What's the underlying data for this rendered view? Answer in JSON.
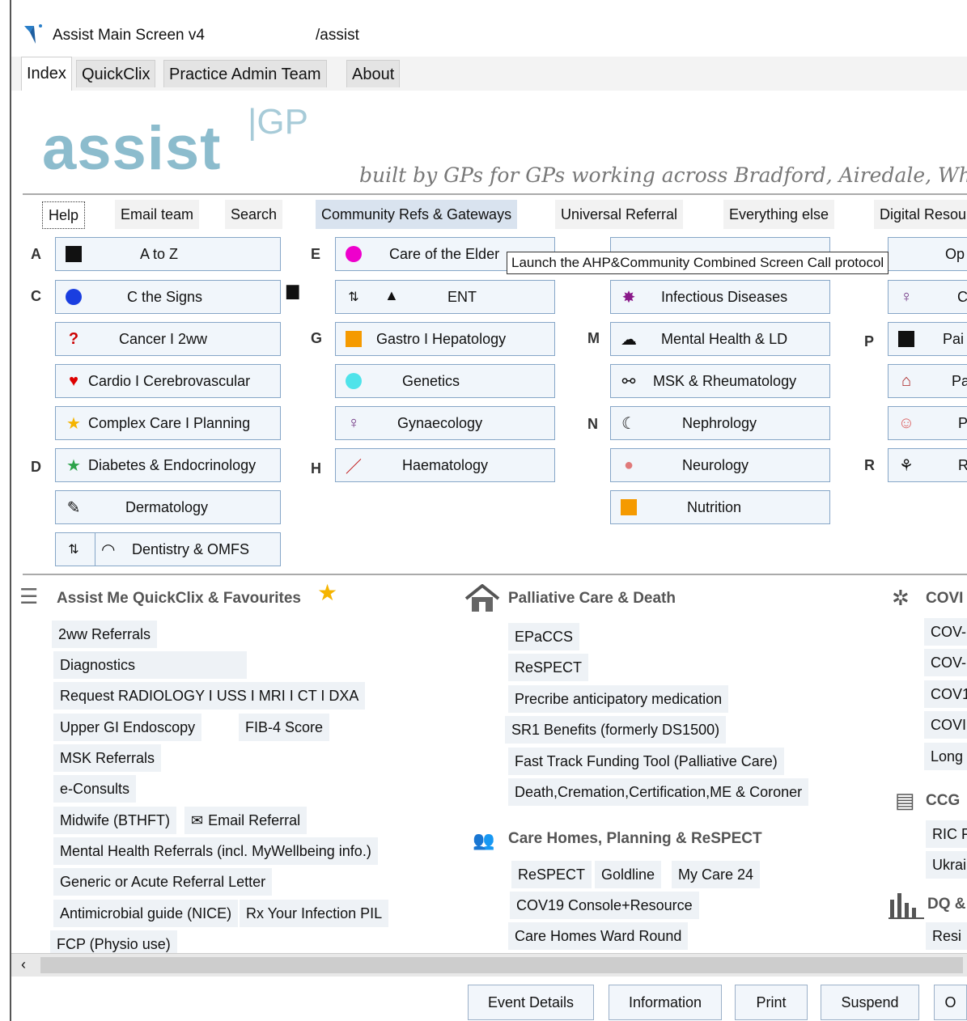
{
  "window": {
    "title": "Assist Main Screen v4",
    "path": "/assist"
  },
  "tabs": [
    {
      "label": "Index",
      "active": true
    },
    {
      "label": "QuickClix"
    },
    {
      "label": "Practice Admin Team"
    },
    {
      "label": "About"
    }
  ],
  "logo": {
    "text": "assist",
    "suffix": "|GP",
    "tagline": "built by GPs for GPs working across Bradford, Airedale, Wharf"
  },
  "nav": [
    "Help",
    "Email team",
    "Search",
    "Community Refs & Gateways",
    "Universal Referral",
    "Everything else",
    "Digital Resou"
  ],
  "tooltip": "Launch the AHP&Community Combined Screen Call protocol",
  "letters": {
    "A": "A",
    "C": "C",
    "D": "D",
    "E": "E",
    "G": "G",
    "H": "H",
    "M": "M",
    "N": "N",
    "P": "P",
    "R": "R"
  },
  "buttons": {
    "atoz": "A to Z",
    "cthesigns": "C the Signs",
    "cancer": "Cancer I 2ww",
    "cardio": "Cardio I Cerebrovascular",
    "complex": "Complex Care I Planning",
    "diabetes": "Diabetes & Endocrinology",
    "dermatology": "Dermatology",
    "dentistry": "Dentistry & OMFS",
    "elder": "Care of the Elder",
    "ent": "ENT",
    "gastro": "Gastro I Hepatology",
    "genetics": "Genetics",
    "gynae": "Gynaecology",
    "haematology": "Haematology",
    "infectious": "Infectious Diseases",
    "mental": "Mental Health & LD",
    "msk": "MSK & Rheumatology",
    "nephrology": "Nephrology",
    "neurology": "Neurology",
    "nutrition": "Nutrition",
    "op": "Op",
    "c": "C",
    "pai": "Pai",
    "pa": "Pa",
    "p": "P",
    "r": "R"
  },
  "quickclix": {
    "heading": "Assist Me QuickClix & Favourites",
    "items": {
      "i1": "2ww Referrals",
      "i2": "Diagnostics",
      "i3": "Request RADIOLOGY I USS I MRI I CT I DXA",
      "i4": "Upper GI Endoscopy",
      "i5": "FIB-4 Score",
      "i6": "MSK Referrals",
      "i7": "e-Consults",
      "i8": "Midwife (BTHFT)",
      "i9": "Email Referral",
      "i10": "Mental Health Referrals (incl. MyWellbeing info.)",
      "i11": "Generic or Acute Referral Letter",
      "i12": "Antimicrobial guide (NICE)",
      "i13": "Rx Your Infection PIL",
      "i14": "FCP (Physio use)"
    }
  },
  "palliative": {
    "heading": "Palliative Care & Death",
    "items": {
      "i1": "EPaCCS",
      "i2": "ReSPECT",
      "i3": "Precribe anticipatory medication",
      "i4": "SR1 Benefits (formerly DS1500)",
      "i5": "Fast Track Funding Tool (Palliative Care)",
      "i6": "Death,Cremation,Certification,ME & Coroner"
    }
  },
  "carehomes": {
    "heading": "Care Homes, Planning & ReSPECT",
    "items": {
      "i1": "ReSPECT",
      "i2": "Goldline",
      "i3": "My Care 24",
      "i4": "COV19 Console+Resource",
      "i5": "Care Homes Ward Round"
    }
  },
  "right": {
    "covid_heading": "COVI",
    "covid_items": [
      "COV-",
      "COV-",
      "COV1",
      "COVI",
      "Long"
    ],
    "ccg_heading": "CCG",
    "ccg_items": [
      "RIC F",
      "Ukrai"
    ],
    "dq_heading": "DQ &",
    "dq_items": [
      "Resi"
    ]
  },
  "footer": [
    "Event Details",
    "Information",
    "Print",
    "Suspend",
    "O"
  ]
}
